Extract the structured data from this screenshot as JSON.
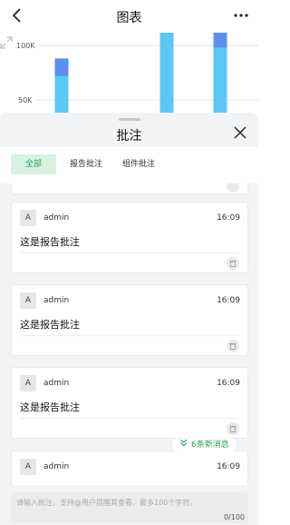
{
  "nav": {
    "title": "图表"
  },
  "chart_data": {
    "type": "bar",
    "yticks": [
      "100K",
      "50K"
    ],
    "series": [
      {
        "values": [
          72000,
          115000,
          98000
        ]
      },
      {
        "values": [
          88000,
          122000,
          140000
        ]
      }
    ],
    "colors": {
      "light": "#5ac8f5",
      "dark": "#5b8ff0"
    }
  },
  "sheet": {
    "title": "批注",
    "tabs": [
      "全部",
      "报告批注",
      "组件批注"
    ]
  },
  "comments": [
    {
      "avatar": "A",
      "user": "admin",
      "time": "16:09",
      "text": "这是报告批注"
    },
    {
      "avatar": "A",
      "user": "admin",
      "time": "16:09",
      "text": "这是报告批注"
    },
    {
      "avatar": "A",
      "user": "admin",
      "time": "16:09",
      "text": "这是报告批注"
    },
    {
      "avatar": "A",
      "user": "admin",
      "time": "16:09",
      "text": ""
    }
  ],
  "new_messages": "6条新消息",
  "input": {
    "placeholder": "请输入批注，支持@用户提醒其查看，最多100个字符。",
    "count": "0/100"
  },
  "accent": "#2f9e5b"
}
